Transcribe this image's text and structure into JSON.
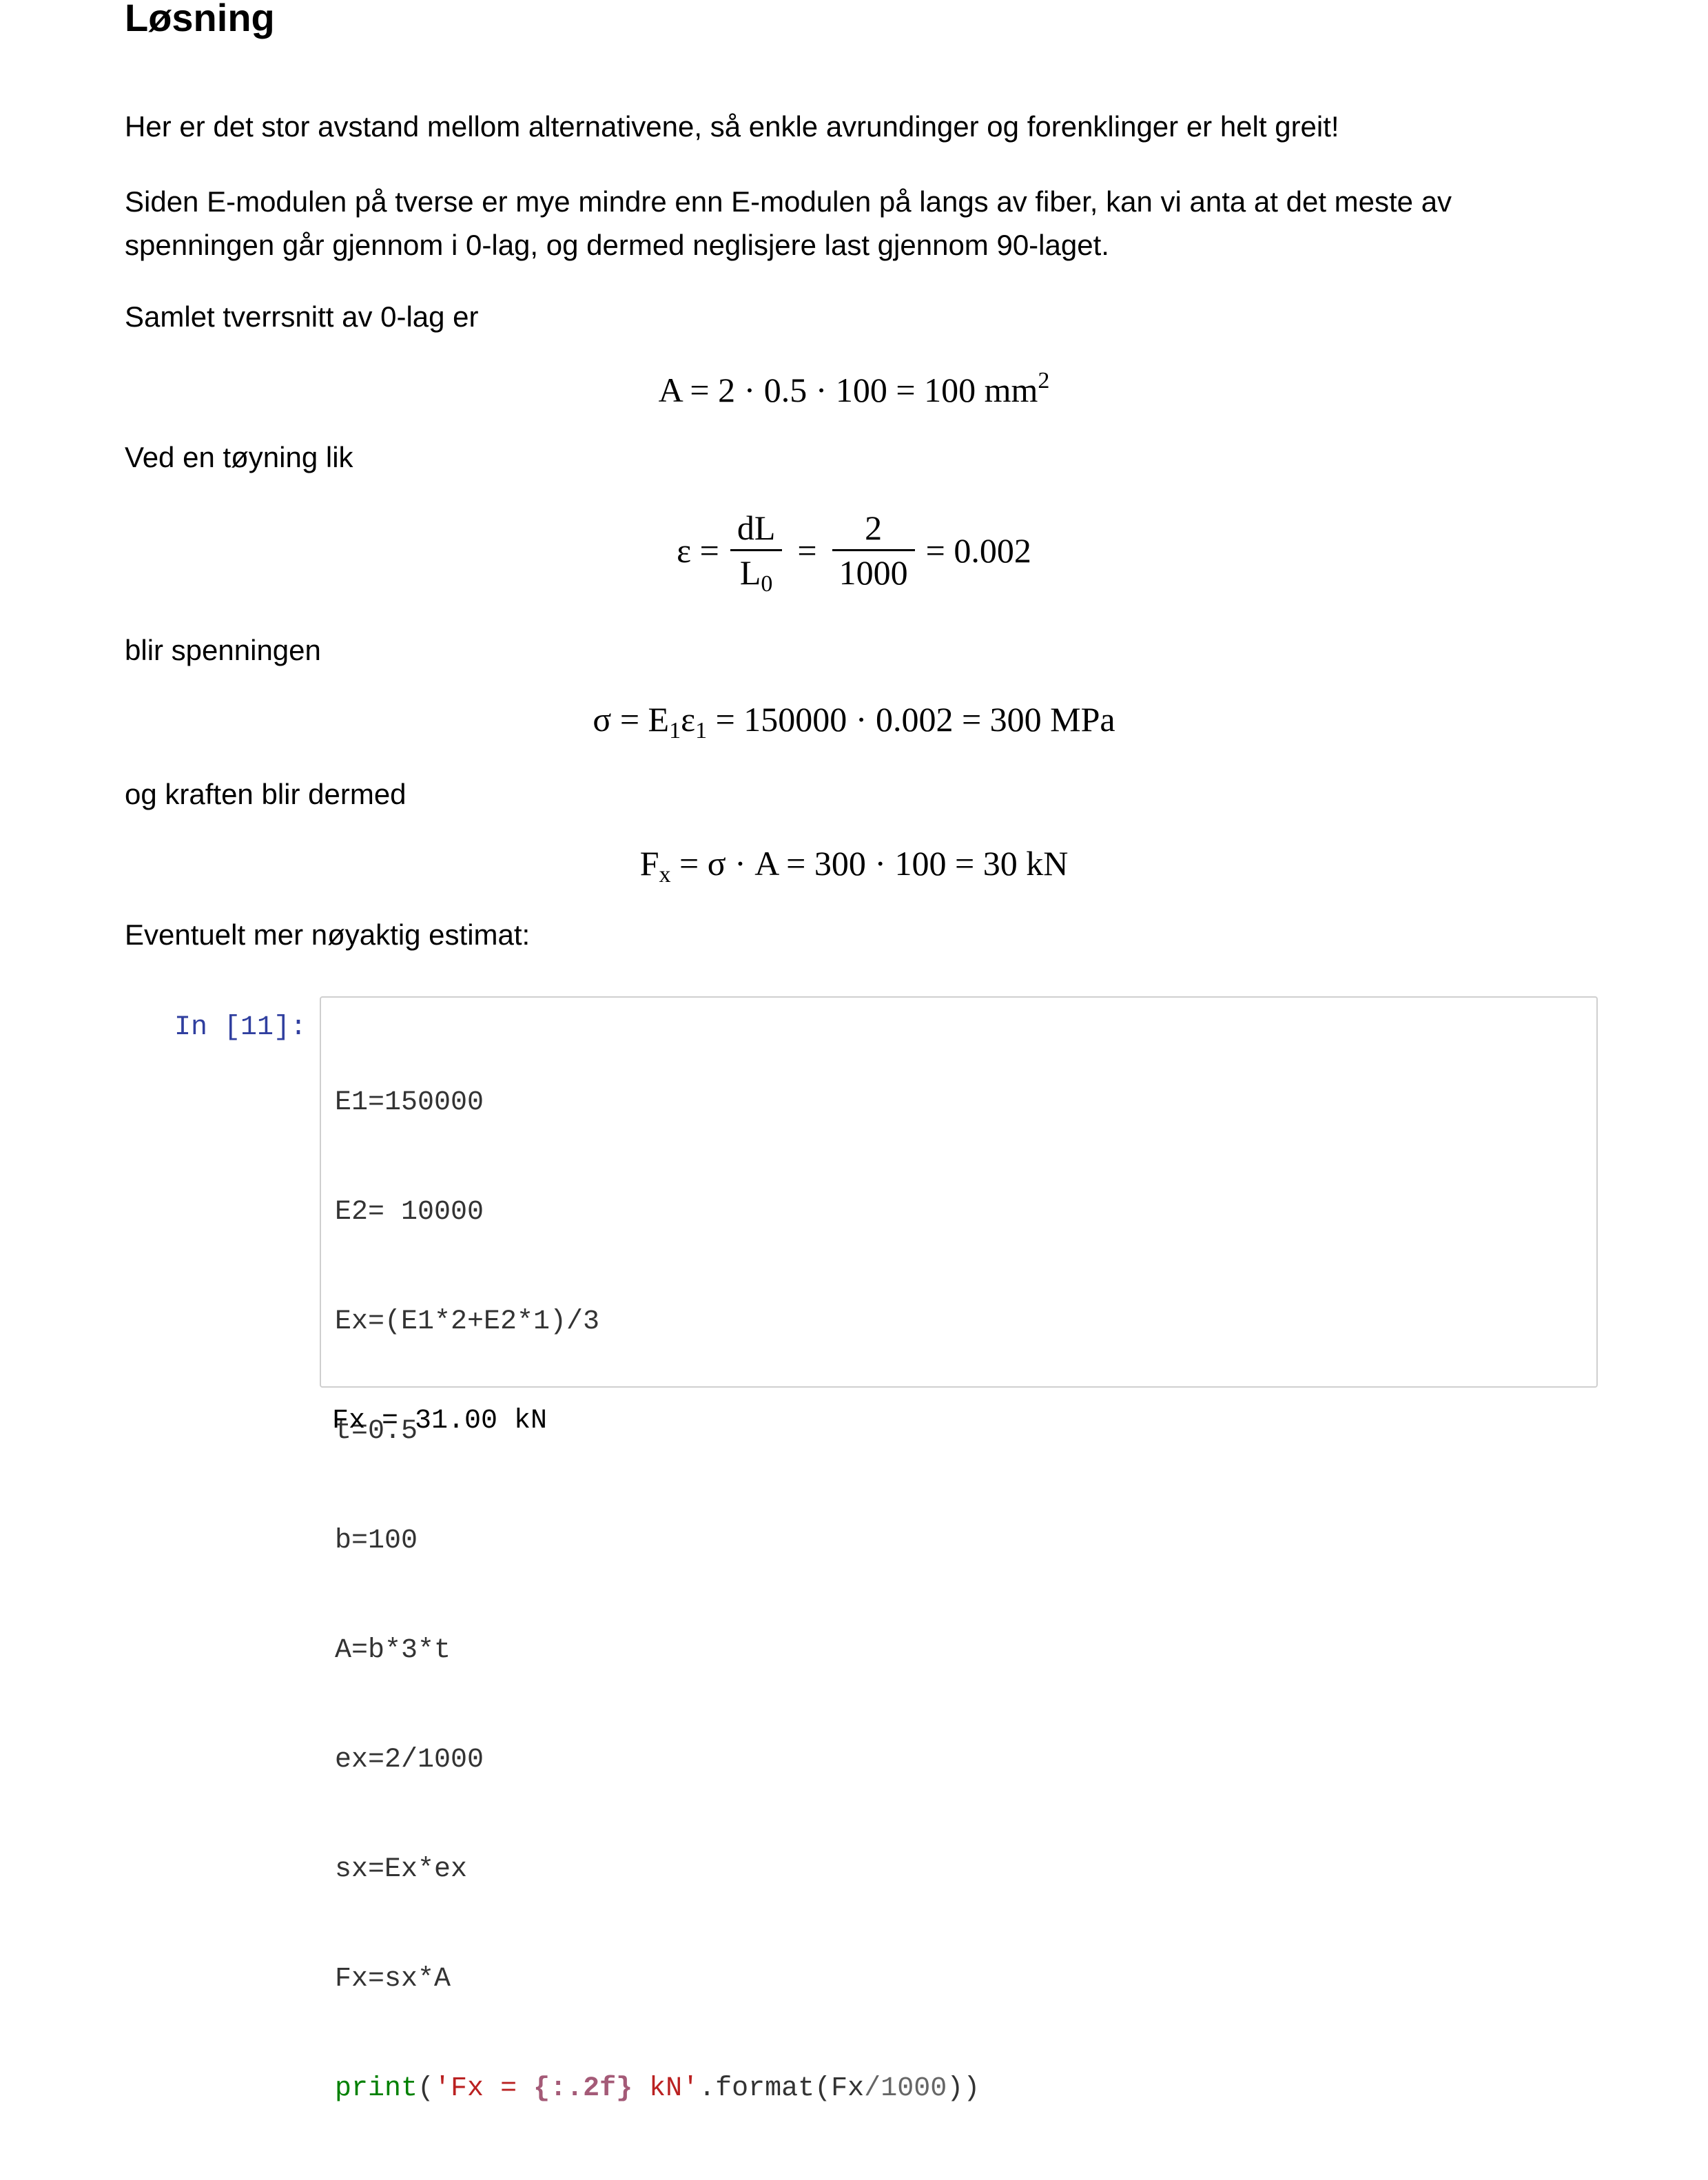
{
  "heading": "Løsning",
  "paragraphs": {
    "p1": "Her er det stor avstand mellom alternativene, så enkle avrundinger og forenklinger er helt greit!",
    "p2": "Siden E-modulen på tverse er mye mindre enn E-modulen på langs av fiber, kan vi anta at det meste av spenningen går gjennom i 0-lag, og dermed neglisjere last gjennom 90-laget.",
    "p3": "Samlet tverrsnitt av 0-lag er",
    "p4": "Ved en tøyning lik",
    "p5": "blir spenningen",
    "p6": "og kraften blir dermed",
    "p7": "Eventuelt mer nøyaktig estimat:"
  },
  "equations": {
    "area": {
      "lhs": "A = 2 · 0.5 · 100 = 100 mm",
      "sup": "2"
    },
    "strain": {
      "lhs": "ε =",
      "frac1_num": "dL",
      "frac1_den_base": "L",
      "frac1_den_sub": "0",
      "eq": "=",
      "frac2_num": "2",
      "frac2_den": "1000",
      "rhs": "= 0.002"
    },
    "stress": {
      "part1": "σ = E",
      "sub1": "1",
      "part2": "ε",
      "sub2": "1",
      "part3": " = 150000 · 0.002 = 300 MPa"
    },
    "force": {
      "part1": "F",
      "sub": "x",
      "part2": " = σ · A = 300 · 100 = 30 kN"
    }
  },
  "code_cell": {
    "prompt": "In [11]:",
    "lines": [
      "E1=150000",
      "E2= 10000",
      "Ex=(E1*2+E2*1)/3",
      "t=0.5",
      "b=100",
      "A=b*3*t",
      "ex=2/1000",
      "sx=Ex*ex",
      "Fx=sx*A"
    ],
    "print_line": {
      "kw": "print",
      "open": "(",
      "str1": "'Fx = ",
      "fmt": "{:.2f}",
      "str2": " kN'",
      "rest1": ".format(Fx",
      "op": "/",
      "num": "1000",
      "close": "))"
    },
    "output": "Fx = 31.00 kN"
  }
}
